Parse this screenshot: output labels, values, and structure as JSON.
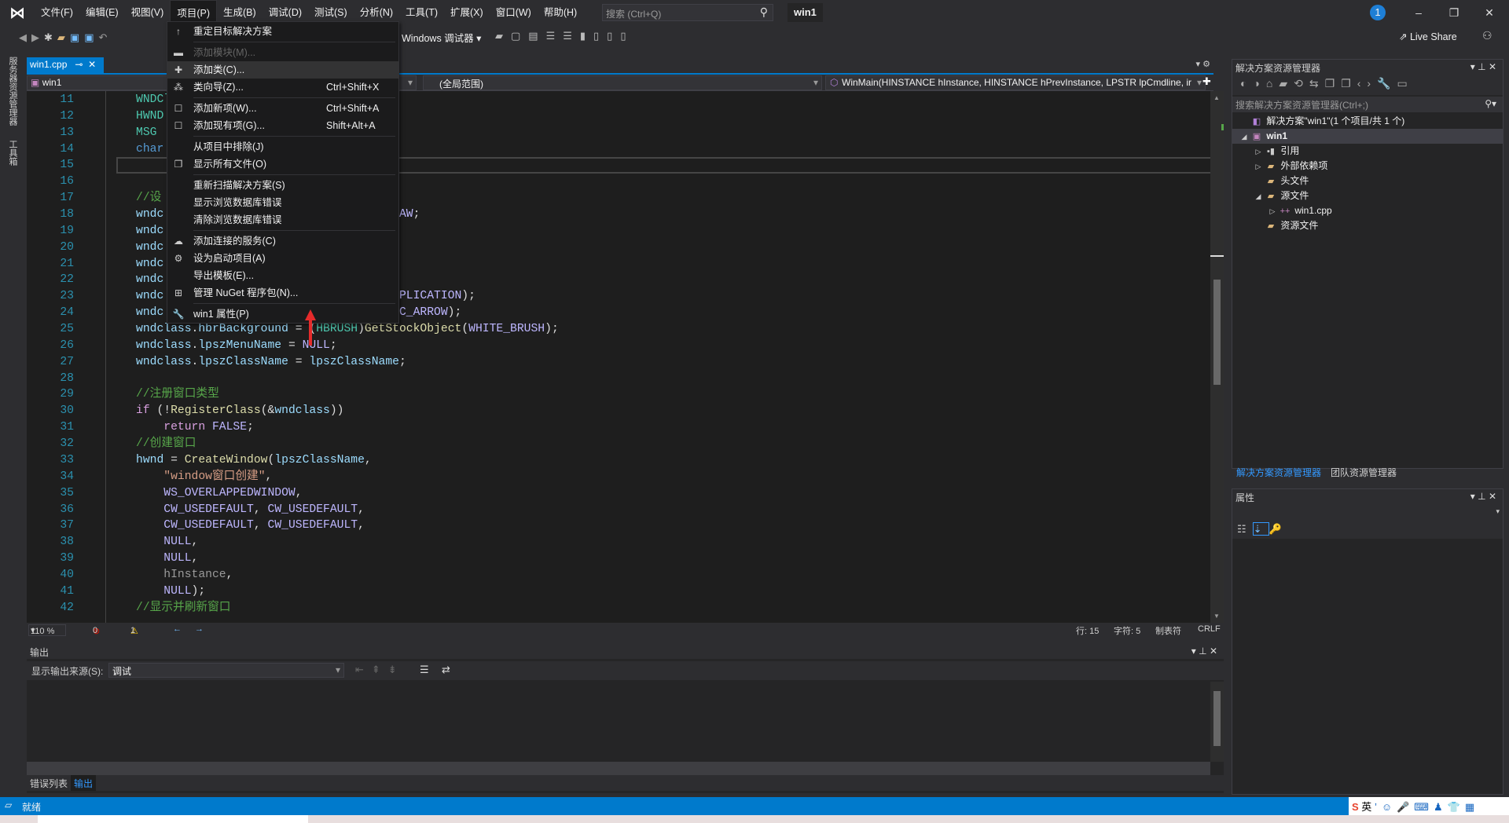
{
  "menubar": {
    "items": [
      "文件(F)",
      "编辑(E)",
      "视图(V)",
      "项目(P)",
      "生成(B)",
      "调试(D)",
      "测试(S)",
      "分析(N)",
      "工具(T)",
      "扩展(X)",
      "窗口(W)",
      "帮助(H)"
    ],
    "active": "项目(P)",
    "search_placeholder": "搜索 (Ctrl+Q)",
    "title": "win1",
    "notification_count": "1"
  },
  "toolbar": {
    "debugger": "Windows 调试器",
    "live_share": "Live Share"
  },
  "side_tabs": [
    "服务器资源管理器",
    "工具箱"
  ],
  "editor": {
    "tab": "win1.cpp",
    "tab_pin": "⊸",
    "tab_close": "✕",
    "nav_project": "win1",
    "nav_scope": "(全局范围)",
    "nav_function": "WinMain(HINSTANCE hInstance, HINSTANCE hPrevInstance, LPSTR lpCmdline, ir",
    "lines": [
      [
        11,
        [
          [
            "WNDCl",
            "ty"
          ]
        ]
      ],
      [
        12,
        [
          [
            "HWND",
            "ty"
          ]
        ]
      ],
      [
        13,
        [
          [
            "MSG",
            "ty"
          ]
        ]
      ],
      [
        14,
        [
          [
            "char",
            "kw"
          ]
        ]
      ],
      [
        15,
        []
      ],
      [
        16,
        []
      ],
      [
        17,
        [
          [
            "//设",
            "cm"
          ]
        ]
      ],
      [
        18,
        [
          [
            "wndc",
            "id"
          ],
          [
            "                                  ",
            "pl"
          ],
          [
            "AW",
            "mc"
          ],
          [
            ";",
            "pl"
          ]
        ]
      ],
      [
        19,
        [
          [
            "wndc",
            "id"
          ]
        ]
      ],
      [
        20,
        [
          [
            "wndc",
            "id"
          ]
        ]
      ],
      [
        21,
        [
          [
            "wndc",
            "id"
          ]
        ]
      ],
      [
        22,
        [
          [
            "wndc",
            "id"
          ]
        ]
      ],
      [
        23,
        [
          [
            "wndc",
            "id"
          ],
          [
            "                                  ",
            "pl"
          ],
          [
            "PLICATION",
            "mc"
          ],
          [
            ");",
            "pl"
          ]
        ]
      ],
      [
        24,
        [
          [
            "wndc",
            "id"
          ],
          [
            "                                  ",
            "pl"
          ],
          [
            "C_ARROW",
            "mc"
          ],
          [
            ");",
            "pl"
          ]
        ]
      ],
      [
        25,
        [
          [
            "wndclass",
            "id"
          ],
          [
            ".",
            "pl"
          ],
          [
            "hbrBackground",
            "id"
          ],
          [
            " = (",
            "pl"
          ],
          [
            "HBRUSH",
            "ty"
          ],
          [
            ")",
            "pl"
          ],
          [
            "GetStockObject",
            "fn"
          ],
          [
            "(",
            "pl"
          ],
          [
            "WHITE_BRUSH",
            "mc"
          ],
          [
            ");",
            "pl"
          ]
        ]
      ],
      [
        26,
        [
          [
            "wndclass",
            "id"
          ],
          [
            ".",
            "pl"
          ],
          [
            "lpszMenuName",
            "id"
          ],
          [
            " = ",
            "pl"
          ],
          [
            "NULL",
            "mc"
          ],
          [
            ";",
            "pl"
          ]
        ]
      ],
      [
        27,
        [
          [
            "wndclass",
            "id"
          ],
          [
            ".",
            "pl"
          ],
          [
            "lpszClassName",
            "id"
          ],
          [
            " = ",
            "pl"
          ],
          [
            "lpszClassName",
            "id"
          ],
          [
            ";",
            "pl"
          ]
        ]
      ],
      [
        28,
        []
      ],
      [
        29,
        [
          [
            "//注册窗口类型",
            "cm"
          ]
        ]
      ],
      [
        30,
        [
          [
            "if",
            "ctl"
          ],
          [
            " (!",
            "pl"
          ],
          [
            "RegisterClass",
            "fn"
          ],
          [
            "(&",
            "pl"
          ],
          [
            "wndclass",
            "id"
          ],
          [
            "))",
            "pl"
          ]
        ]
      ],
      [
        31,
        [
          [
            "    ",
            "pl"
          ],
          [
            "return",
            "ctl"
          ],
          [
            " ",
            "pl"
          ],
          [
            "FALSE",
            "mc"
          ],
          [
            ";",
            "pl"
          ]
        ]
      ],
      [
        32,
        [
          [
            "//创建窗口",
            "cm"
          ]
        ]
      ],
      [
        33,
        [
          [
            "hwnd",
            "id"
          ],
          [
            " = ",
            "pl"
          ],
          [
            "CreateWindow",
            "fn"
          ],
          [
            "(",
            "pl"
          ],
          [
            "lpszClassName",
            "id"
          ],
          [
            ",",
            "pl"
          ]
        ]
      ],
      [
        34,
        [
          [
            "    ",
            "pl"
          ],
          [
            "\"window窗口创建\"",
            "st"
          ],
          [
            ",",
            "pl"
          ]
        ]
      ],
      [
        35,
        [
          [
            "    ",
            "pl"
          ],
          [
            "WS_OVERLAPPEDWINDOW",
            "mc"
          ],
          [
            ",",
            "pl"
          ]
        ]
      ],
      [
        36,
        [
          [
            "    ",
            "pl"
          ],
          [
            "CW_USEDEFAULT",
            "mc"
          ],
          [
            ", ",
            "pl"
          ],
          [
            "CW_USEDEFAULT",
            "mc"
          ],
          [
            ",",
            "pl"
          ]
        ]
      ],
      [
        37,
        [
          [
            "    ",
            "pl"
          ],
          [
            "CW_USEDEFAULT",
            "mc"
          ],
          [
            ", ",
            "pl"
          ],
          [
            "CW_USEDEFAULT",
            "mc"
          ],
          [
            ",",
            "pl"
          ]
        ]
      ],
      [
        38,
        [
          [
            "    ",
            "pl"
          ],
          [
            "NULL",
            "mc"
          ],
          [
            ",",
            "pl"
          ]
        ]
      ],
      [
        39,
        [
          [
            "    ",
            "pl"
          ],
          [
            "NULL",
            "mc"
          ],
          [
            ",",
            "pl"
          ]
        ]
      ],
      [
        40,
        [
          [
            "    ",
            "pl"
          ],
          [
            "hInstance",
            "pm"
          ],
          [
            ",",
            "pl"
          ]
        ]
      ],
      [
        41,
        [
          [
            "    ",
            "pl"
          ],
          [
            "NULL",
            "mc"
          ],
          [
            ");",
            "pl"
          ]
        ]
      ],
      [
        42,
        [
          [
            "//显示并刷新窗口",
            "cm"
          ]
        ]
      ]
    ]
  },
  "editor_status": {
    "zoom": "110 %",
    "errors": "0",
    "warnings": "1",
    "line": "行: 15",
    "char": "字符: 5",
    "tabs": "制表符",
    "eol": "CRLF"
  },
  "project_menu": [
    {
      "label": "重定目标解决方案",
      "icon": "arrow-up-icon",
      "glyph": "↑"
    },
    {
      "sep": true
    },
    {
      "label": "添加模块(M)...",
      "icon": "module-icon",
      "glyph": "▬",
      "disabled": true
    },
    {
      "label": "添加类(C)...",
      "icon": "add-class-icon",
      "glyph": "✚",
      "highlighted": true
    },
    {
      "label": "类向导(Z)...",
      "icon": "class-wizard-icon",
      "glyph": "⁂",
      "shortcut": "Ctrl+Shift+X"
    },
    {
      "sep": true
    },
    {
      "label": "添加新项(W)...",
      "icon": "add-new-item-icon",
      "glyph": "☐",
      "shortcut": "Ctrl+Shift+A"
    },
    {
      "label": "添加现有项(G)...",
      "icon": "add-existing-item-icon",
      "glyph": "☐",
      "shortcut": "Shift+Alt+A"
    },
    {
      "sep": true
    },
    {
      "label": "从项目中排除(J)"
    },
    {
      "label": "显示所有文件(O)",
      "icon": "show-all-files-icon",
      "glyph": "❐"
    },
    {
      "sep": true
    },
    {
      "label": "重新扫描解决方案(S)"
    },
    {
      "label": "显示浏览数据库错误"
    },
    {
      "label": "清除浏览数据库错误"
    },
    {
      "sep": true
    },
    {
      "label": "添加连接的服务(C)",
      "icon": "connected-service-icon",
      "glyph": "☁"
    },
    {
      "label": "设为启动项目(A)",
      "icon": "gear-icon",
      "glyph": "⚙"
    },
    {
      "label": "导出模板(E)..."
    },
    {
      "label": "管理 NuGet 程序包(N)...",
      "icon": "nuget-icon",
      "glyph": "⊞"
    },
    {
      "sep": true
    },
    {
      "label": "win1 属性(P)",
      "icon": "wrench-icon",
      "glyph": "🔧"
    }
  ],
  "output": {
    "title": "输出",
    "source_label": "显示输出来源(S):",
    "source_value": "调试",
    "tabs": [
      "错误列表",
      "输出"
    ],
    "active_tab": "输出"
  },
  "status": {
    "text": "就绪",
    "ime": "英"
  },
  "solution_explorer": {
    "title": "解决方案资源管理器",
    "search_placeholder": "搜索解决方案资源管理器(Ctrl+;)",
    "tree": [
      {
        "label": "解决方案\"win1\"(1 个项目/共 1 个)",
        "level": 0,
        "twisty": "",
        "icon": "solution-icon"
      },
      {
        "label": "win1",
        "level": 0,
        "twisty": "◢",
        "icon": "project-icon",
        "selected": true
      },
      {
        "label": "引用",
        "level": 1,
        "twisty": "▷",
        "icon": "references-icon"
      },
      {
        "label": "外部依赖项",
        "level": 1,
        "twisty": "▷",
        "icon": "external-deps-icon"
      },
      {
        "label": "头文件",
        "level": 1,
        "twisty": "",
        "icon": "folder-icon"
      },
      {
        "label": "源文件",
        "level": 1,
        "twisty": "◢",
        "icon": "folder-icon"
      },
      {
        "label": "win1.cpp",
        "level": 2,
        "twisty": "▷",
        "icon": "cpp-file-icon"
      },
      {
        "label": "资源文件",
        "level": 1,
        "twisty": "",
        "icon": "folder-icon"
      }
    ],
    "tabs": [
      "解决方案资源管理器",
      "团队资源管理器"
    ]
  },
  "properties": {
    "title": "属性"
  },
  "colors": {
    "accent": "#007acc",
    "menu_bg": "#1b1b1c",
    "editor_bg": "#1e1e1e",
    "arrow": "#e52b2b"
  }
}
